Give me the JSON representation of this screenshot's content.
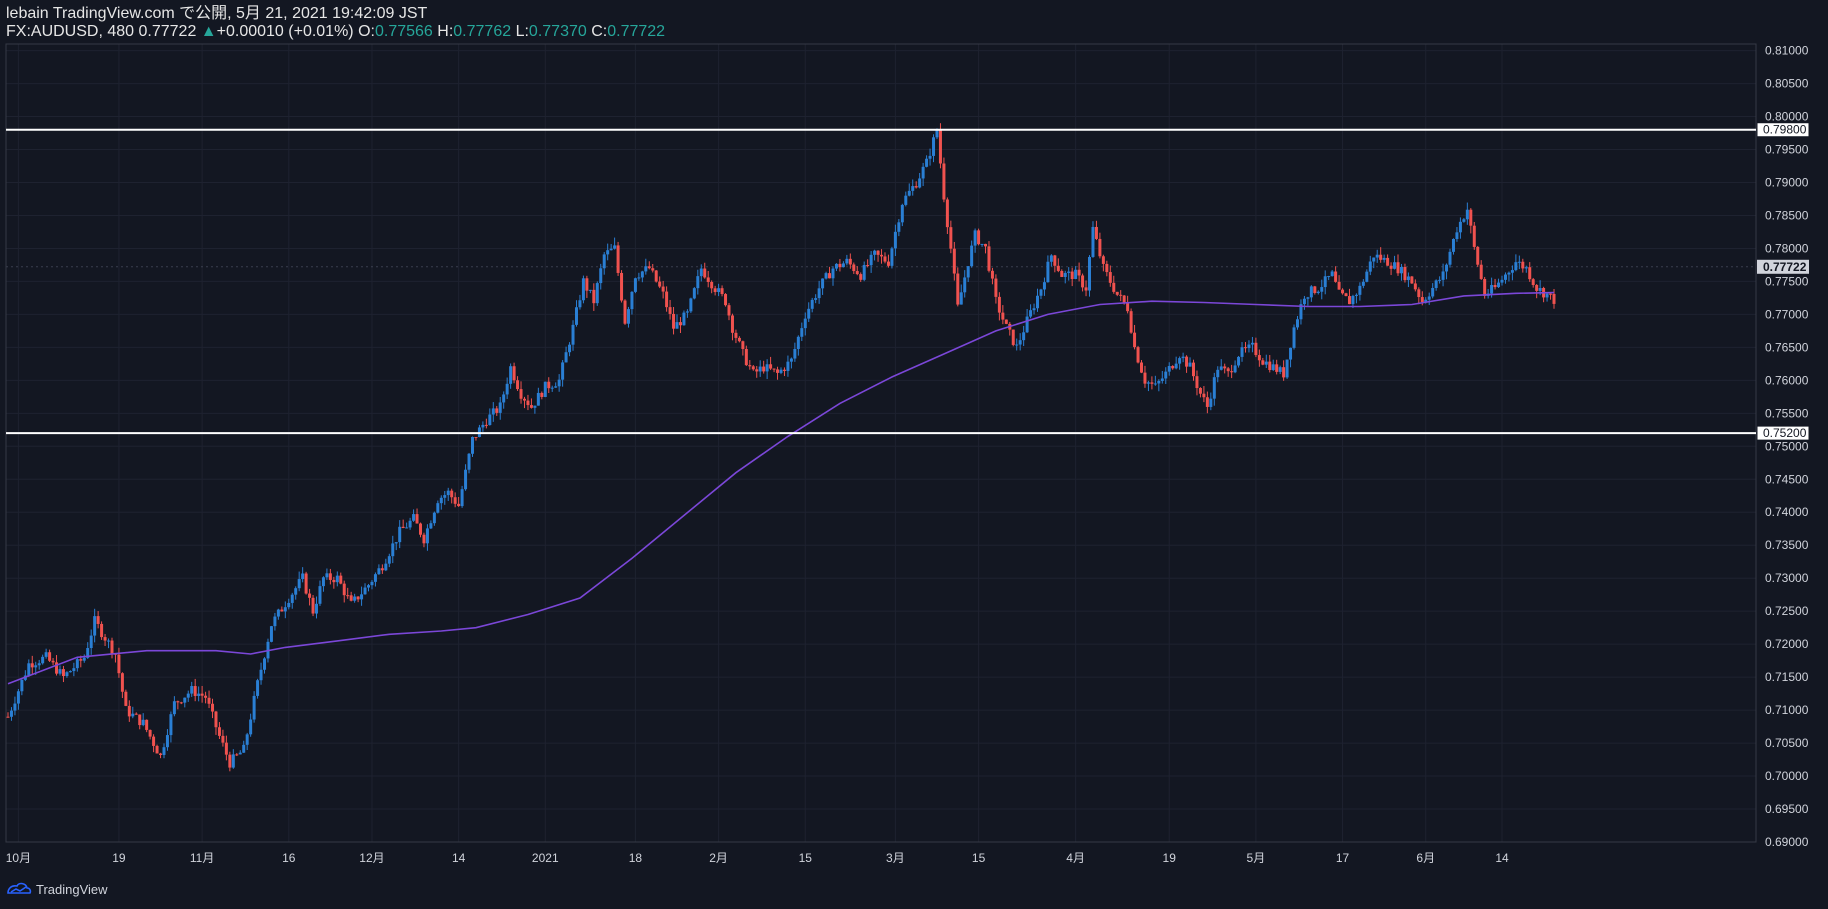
{
  "header": {
    "publish_line": "lebain TradingView.com で公開, 5月 21, 2021 19:42:09 JST",
    "symbol": "FX:AUDUSD, 480",
    "last": "0.77722",
    "change_arrow": "▲",
    "change": "+0.00010 (+0.01%)",
    "o_label": "O:",
    "o_value": "0.77566",
    "h_label": "H:",
    "h_value": "0.77762",
    "l_label": "L:",
    "l_value": "0.77370",
    "c_label": "C:",
    "c_value": "0.77722"
  },
  "footer": {
    "brand": "TradingView",
    "icon": "tradingview-logo-icon"
  },
  "colors": {
    "background": "#131722",
    "up_candle": "#2a7fd4",
    "down_candle": "#f0524f",
    "moving_average": "#7b47d8",
    "horizontal_line": "#ffffff",
    "grid": "#1e2230",
    "axis_text": "#d1d4dc",
    "last_price_tag": "#d1d4dc"
  },
  "chart_data": {
    "type": "candlestick",
    "symbol": "FX:AUDUSD",
    "timeframe": "480",
    "ylim": [
      0.69,
      0.811
    ],
    "y_ticks": [
      "0.81000",
      "0.80500",
      "0.80000",
      "0.79500",
      "0.79000",
      "0.78500",
      "0.78000",
      "0.77500",
      "0.77000",
      "0.76500",
      "0.76000",
      "0.75500",
      "0.75000",
      "0.74500",
      "0.74000",
      "0.73500",
      "0.73000",
      "0.72500",
      "0.72000",
      "0.71500",
      "0.71000",
      "0.70500",
      "0.70000",
      "0.69500",
      "0.69000"
    ],
    "x_ticks": [
      "10月",
      "19",
      "11月",
      "16",
      "12月",
      "14",
      "2021",
      "18",
      "2月",
      "15",
      "3月",
      "15",
      "4月",
      "19",
      "5月",
      "17",
      "6月",
      "14"
    ],
    "horizontal_lines": [
      {
        "price": 0.798,
        "label": "0.79800"
      },
      {
        "price": 0.752,
        "label": "0.75200"
      }
    ],
    "last_price_label": "0.77722",
    "close_path": [
      [
        0,
        0.709
      ],
      [
        6,
        0.717
      ],
      [
        11,
        0.718
      ],
      [
        16,
        0.715
      ],
      [
        22,
        0.718
      ],
      [
        25,
        0.7235
      ],
      [
        31,
        0.7185
      ],
      [
        34,
        0.71
      ],
      [
        39,
        0.708
      ],
      [
        44,
        0.703
      ],
      [
        48,
        0.711
      ],
      [
        53,
        0.713
      ],
      [
        57,
        0.712
      ],
      [
        61,
        0.706
      ],
      [
        64,
        0.702
      ],
      [
        68,
        0.704
      ],
      [
        72,
        0.714
      ],
      [
        76,
        0.723
      ],
      [
        81,
        0.727
      ],
      [
        85,
        0.73
      ],
      [
        88,
        0.725
      ],
      [
        91,
        0.73
      ],
      [
        95,
        0.73
      ],
      [
        99,
        0.726
      ],
      [
        104,
        0.729
      ],
      [
        108,
        0.732
      ],
      [
        113,
        0.737
      ],
      [
        117,
        0.739
      ],
      [
        120,
        0.736
      ],
      [
        124,
        0.742
      ],
      [
        127,
        0.743
      ],
      [
        130,
        0.741
      ],
      [
        134,
        0.751
      ],
      [
        138,
        0.754
      ],
      [
        142,
        0.756
      ],
      [
        145,
        0.762
      ],
      [
        148,
        0.758
      ],
      [
        151,
        0.756
      ],
      [
        155,
        0.759
      ],
      [
        159,
        0.76
      ],
      [
        163,
        0.768
      ],
      [
        166,
        0.775
      ],
      [
        169,
        0.772
      ],
      [
        172,
        0.779
      ],
      [
        175,
        0.78
      ],
      [
        178,
        0.769
      ],
      [
        181,
        0.776
      ],
      [
        185,
        0.777
      ],
      [
        189,
        0.773
      ],
      [
        192,
        0.768
      ],
      [
        196,
        0.77
      ],
      [
        200,
        0.777
      ],
      [
        204,
        0.774
      ],
      [
        207,
        0.772
      ],
      [
        209,
        0.768
      ],
      [
        212,
        0.764
      ],
      [
        215,
        0.761
      ],
      [
        218,
        0.762
      ],
      [
        222,
        0.761
      ],
      [
        226,
        0.763
      ],
      [
        230,
        0.77
      ],
      [
        234,
        0.774
      ],
      [
        238,
        0.777
      ],
      [
        242,
        0.778
      ],
      [
        246,
        0.776
      ],
      [
        250,
        0.779
      ],
      [
        254,
        0.778
      ],
      [
        258,
        0.787
      ],
      [
        262,
        0.79
      ],
      [
        265,
        0.793
      ],
      [
        268,
        0.798
      ],
      [
        270,
        0.788
      ],
      [
        272,
        0.78
      ],
      [
        274,
        0.771
      ],
      [
        277,
        0.778
      ],
      [
        279,
        0.782
      ],
      [
        282,
        0.78
      ],
      [
        285,
        0.772
      ],
      [
        288,
        0.768
      ],
      [
        291,
        0.765
      ],
      [
        294,
        0.769
      ],
      [
        298,
        0.774
      ],
      [
        301,
        0.779
      ],
      [
        304,
        0.776
      ],
      [
        308,
        0.776
      ],
      [
        311,
        0.774
      ],
      [
        313,
        0.783
      ],
      [
        316,
        0.777
      ],
      [
        320,
        0.773
      ],
      [
        323,
        0.771
      ],
      [
        325,
        0.765
      ],
      [
        328,
        0.76
      ],
      [
        331,
        0.759
      ],
      [
        334,
        0.761
      ],
      [
        338,
        0.764
      ],
      [
        341,
        0.762
      ],
      [
        344,
        0.758
      ],
      [
        346,
        0.756
      ],
      [
        349,
        0.762
      ],
      [
        352,
        0.761
      ],
      [
        355,
        0.764
      ],
      [
        359,
        0.765
      ],
      [
        362,
        0.763
      ],
      [
        365,
        0.762
      ],
      [
        368,
        0.761
      ],
      [
        371,
        0.768
      ],
      [
        374,
        0.773
      ],
      [
        378,
        0.774
      ],
      [
        382,
        0.776
      ],
      [
        384,
        0.773
      ],
      [
        387,
        0.772
      ],
      [
        390,
        0.774
      ],
      [
        394,
        0.779
      ],
      [
        398,
        0.778
      ],
      [
        401,
        0.777
      ],
      [
        405,
        0.775
      ],
      [
        408,
        0.772
      ],
      [
        411,
        0.774
      ],
      [
        414,
        0.776
      ],
      [
        418,
        0.783
      ],
      [
        421,
        0.786
      ],
      [
        423,
        0.78
      ],
      [
        426,
        0.773
      ],
      [
        429,
        0.774
      ],
      [
        432,
        0.776
      ],
      [
        435,
        0.778
      ],
      [
        438,
        0.777
      ],
      [
        441,
        0.774
      ],
      [
        444,
        0.773
      ],
      [
        446,
        0.7722
      ]
    ],
    "series": [
      {
        "name": "moving_average",
        "points": [
          [
            0,
            0.714
          ],
          [
            20,
            0.718
          ],
          [
            40,
            0.719
          ],
          [
            60,
            0.719
          ],
          [
            70,
            0.7185
          ],
          [
            80,
            0.7195
          ],
          [
            95,
            0.7205
          ],
          [
            110,
            0.7215
          ],
          [
            125,
            0.722
          ],
          [
            135,
            0.7225
          ],
          [
            150,
            0.7245
          ],
          [
            165,
            0.727
          ],
          [
            180,
            0.733
          ],
          [
            195,
            0.7395
          ],
          [
            210,
            0.746
          ],
          [
            225,
            0.7515
          ],
          [
            240,
            0.7565
          ],
          [
            255,
            0.7605
          ],
          [
            270,
            0.764
          ],
          [
            285,
            0.7675
          ],
          [
            300,
            0.77
          ],
          [
            315,
            0.7715
          ],
          [
            330,
            0.772
          ],
          [
            345,
            0.7718
          ],
          [
            360,
            0.7715
          ],
          [
            375,
            0.7712
          ],
          [
            390,
            0.7712
          ],
          [
            405,
            0.7715
          ],
          [
            420,
            0.7728
          ],
          [
            435,
            0.7732
          ],
          [
            446,
            0.7733
          ]
        ]
      }
    ]
  }
}
